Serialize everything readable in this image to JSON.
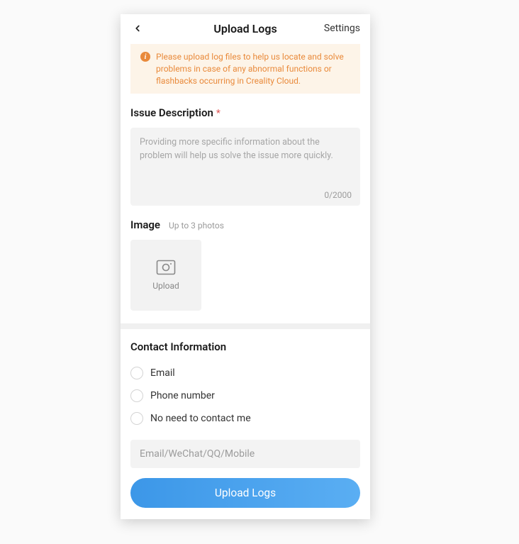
{
  "header": {
    "title": "Upload Logs",
    "settings": "Settings"
  },
  "notice": {
    "text": "Please upload log files to help us locate and solve problems in case of any abnormal functions or flashbacks occurring in Creality Cloud."
  },
  "issue": {
    "label": "Issue Description",
    "required_mark": "*",
    "placeholder": "Providing more specific information about the problem will help us solve the issue more quickly.",
    "char_count": "0/2000"
  },
  "image": {
    "label": "Image",
    "sublabel": "Up to 3 photos",
    "upload_label": "Upload"
  },
  "contact": {
    "title": "Contact Information",
    "options": {
      "email": "Email",
      "phone": "Phone number",
      "none": "No need to contact me"
    },
    "input_placeholder": "Email/WeChat/QQ/Mobile"
  },
  "submit": {
    "label": "Upload Logs"
  }
}
